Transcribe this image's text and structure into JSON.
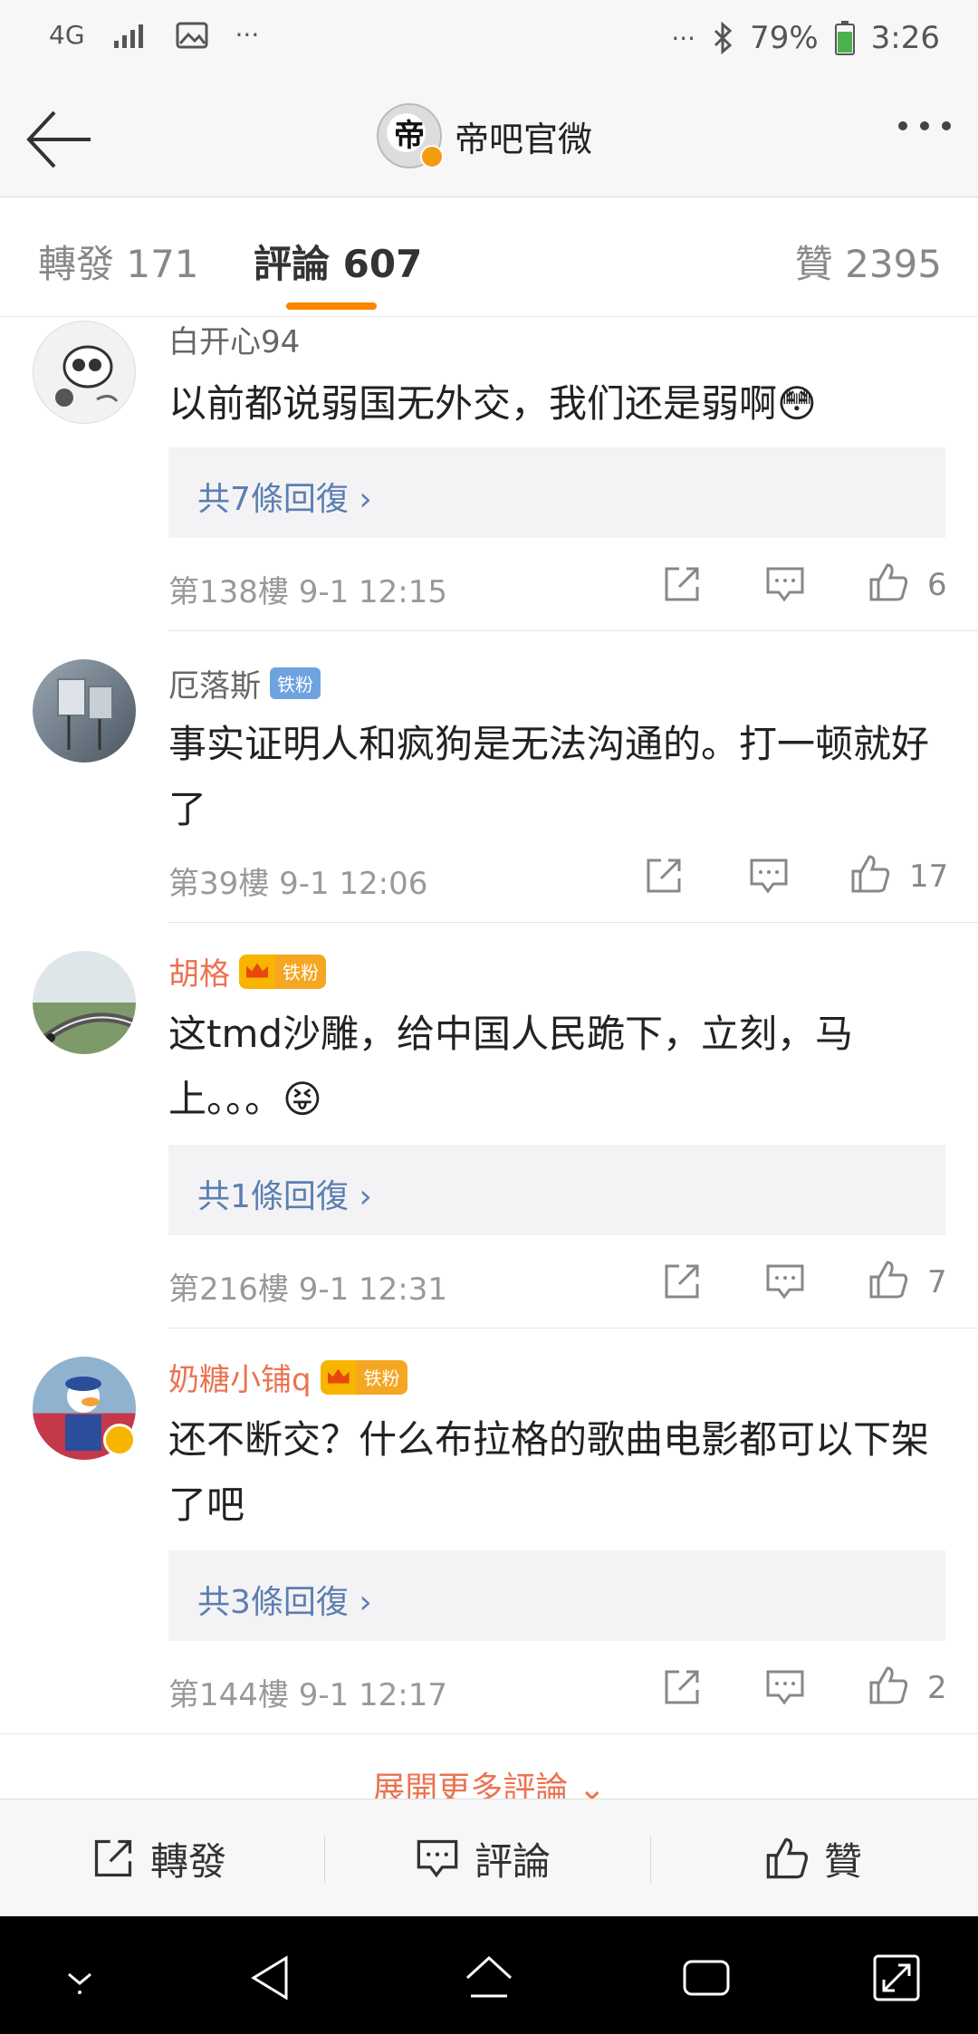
{
  "status_bar": {
    "network": "4G",
    "dots_left": "···",
    "dots_right": "···",
    "battery": "79%",
    "time": "3:26"
  },
  "nav": {
    "avatar_char": "帝",
    "title": "帝吧官微"
  },
  "tabs": {
    "reposts": "轉發 171",
    "comments": "評論 607",
    "likes": "贊 2395"
  },
  "comments": [
    {
      "user": "白开心94",
      "text": "以前都说弱国无外交，我们还是弱啊😳",
      "replies": "共7條回復 ›",
      "meta": "第138樓  9-1 12:15",
      "likes": "6"
    },
    {
      "user": "厄落斯",
      "badge": "铁粉",
      "text": "事实证明人和疯狗是无法沟通的。打一顿就好了",
      "meta": "第39樓  9-1 12:06",
      "likes": "17"
    },
    {
      "user": "胡格",
      "badge": "铁粉",
      "text": "这tmd沙雕，给中国人民跪下，立刻，马上。。。😝",
      "replies": "共1條回復 ›",
      "meta": "第216樓  9-1 12:31",
      "likes": "7"
    },
    {
      "user": "奶糖小铺q",
      "badge": "铁粉",
      "text": "还不断交？什么布拉格的歌曲电影都可以下架了吧",
      "replies": "共3條回復 ›",
      "meta": "第144樓  9-1 12:17",
      "likes": "2"
    }
  ],
  "expand_more": "展開更多評論 ⌄",
  "bottom_bar": {
    "repost": "轉發",
    "comment": "評論",
    "like": "贊"
  },
  "colors": {
    "accent": "#ff8200",
    "username_vip": "#eb7350",
    "link": "#5b7fb0",
    "fan_badge": "#6ea3e0"
  }
}
